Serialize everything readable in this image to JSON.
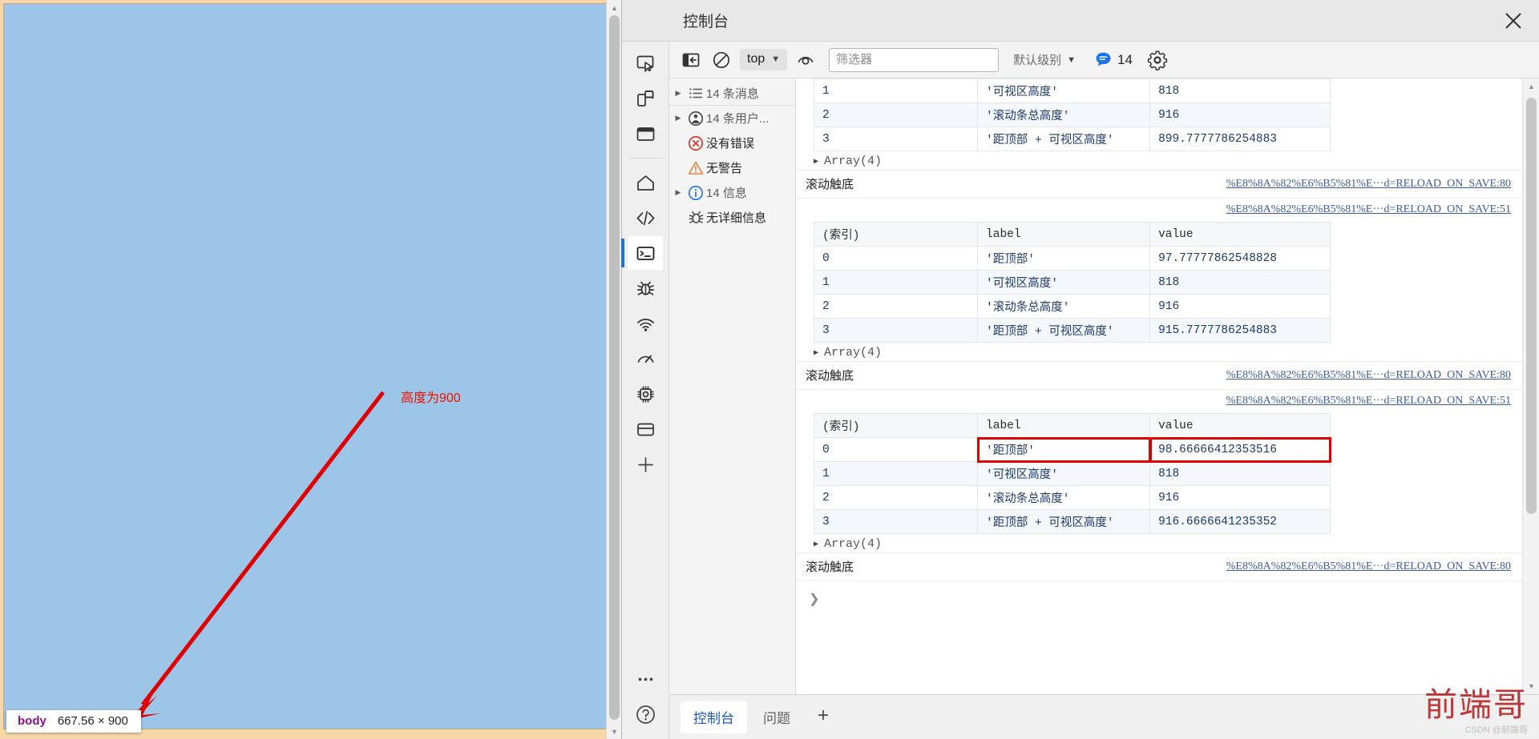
{
  "page": {
    "annotation_text": "高度为900",
    "inspect_badge": {
      "tag": "body",
      "dimensions": "667.56 × 900"
    }
  },
  "devtools": {
    "window_title": "控制台",
    "close_label": "✕",
    "rail_icons": [
      {
        "name": "inspect-element-icon",
        "title": "检查元素"
      },
      {
        "name": "device-toolbar-icon",
        "title": "设备工具栏"
      },
      {
        "name": "elements-panel-icon",
        "title": "元素"
      },
      {
        "name": "home-icon",
        "title": "主页"
      },
      {
        "name": "sources-code-icon",
        "title": "源代码"
      },
      {
        "name": "console-icon",
        "title": "控制台"
      },
      {
        "name": "bug-icon",
        "title": "调试"
      },
      {
        "name": "network-icon",
        "title": "网络"
      },
      {
        "name": "performance-icon",
        "title": "性能"
      },
      {
        "name": "memory-chip-icon",
        "title": "内存"
      },
      {
        "name": "application-icon",
        "title": "应用"
      },
      {
        "name": "add-panel-icon",
        "title": "更多工具"
      }
    ],
    "toolbar": {
      "sidebar_toggle": "显示控制台侧边栏",
      "clear_console": "清除控制台",
      "context_value": "top",
      "eye_toggle": "实时表达式",
      "filter_placeholder": "筛选器",
      "filter_value": "",
      "level_label": "默认级别",
      "message_count": "14",
      "settings_label": "设置"
    },
    "sidebar_tree": [
      {
        "label": "14 条消息",
        "icon": "list-icon",
        "expandable": true,
        "muted": true
      },
      {
        "label": "14 条用户...",
        "icon": "user-message-icon",
        "expandable": true,
        "muted": true
      },
      {
        "label": "没有错误",
        "icon": "error-circle-icon",
        "expandable": false,
        "muted": false
      },
      {
        "label": "无警告",
        "icon": "warning-triangle-icon",
        "expandable": false,
        "muted": false
      },
      {
        "label": "14 信息",
        "icon": "info-circle-icon",
        "expandable": true,
        "muted": true
      },
      {
        "label": "无详细信息",
        "icon": "bug-icon",
        "expandable": false,
        "muted": false
      }
    ],
    "log": {
      "source_link_80": "%E8%8A%82%E6%B5%81%E···d=RELOAD_ON_SAVE:80",
      "source_link_51": "%E8%8A%82%E6%B5%81%E···d=RELOAD_ON_SAVE:51",
      "array_expand_label": "Array(4)",
      "scroll_bottom_label": "滚动触底",
      "headers": {
        "index": "(索引)",
        "label": "label",
        "value": "value"
      },
      "table_partial_rows": [
        {
          "index": "1",
          "label": "'可视区高度'",
          "value": "818"
        },
        {
          "index": "2",
          "label": "'滚动条总高度'",
          "value": "916"
        },
        {
          "index": "3",
          "label": "'距顶部 + 可视区高度'",
          "value": "899.7777786254883"
        }
      ],
      "table_2_rows": [
        {
          "index": "0",
          "label": "'距顶部'",
          "value": "97.77777862548828"
        },
        {
          "index": "1",
          "label": "'可视区高度'",
          "value": "818"
        },
        {
          "index": "2",
          "label": "'滚动条总高度'",
          "value": "916"
        },
        {
          "index": "3",
          "label": "'距顶部 + 可视区高度'",
          "value": "915.7777786254883"
        }
      ],
      "table_3_rows": [
        {
          "index": "0",
          "label": "'距顶部'",
          "value": "98.66666412353516",
          "highlighted": true
        },
        {
          "index": "1",
          "label": "'可视区高度'",
          "value": "818"
        },
        {
          "index": "2",
          "label": "'滚动条总高度'",
          "value": "916"
        },
        {
          "index": "3",
          "label": "'距顶部 + 可视区高度'",
          "value": "916.6666641235352"
        }
      ]
    },
    "drawer_tabs": [
      {
        "label": "控制台",
        "active": true
      },
      {
        "label": "问题",
        "active": false
      }
    ],
    "drawer_add": "+",
    "help_icon": "help-circle-icon"
  },
  "watermark": {
    "big": "前端哥",
    "small": "CSDN @前端哥"
  },
  "colors": {
    "accent": "#1a73e8",
    "highlight": "#e00000",
    "page_bg": "#9dc5e8",
    "page_frame": "#f7d6a8",
    "string": "#c41a16",
    "number": "#1c3a6e"
  }
}
